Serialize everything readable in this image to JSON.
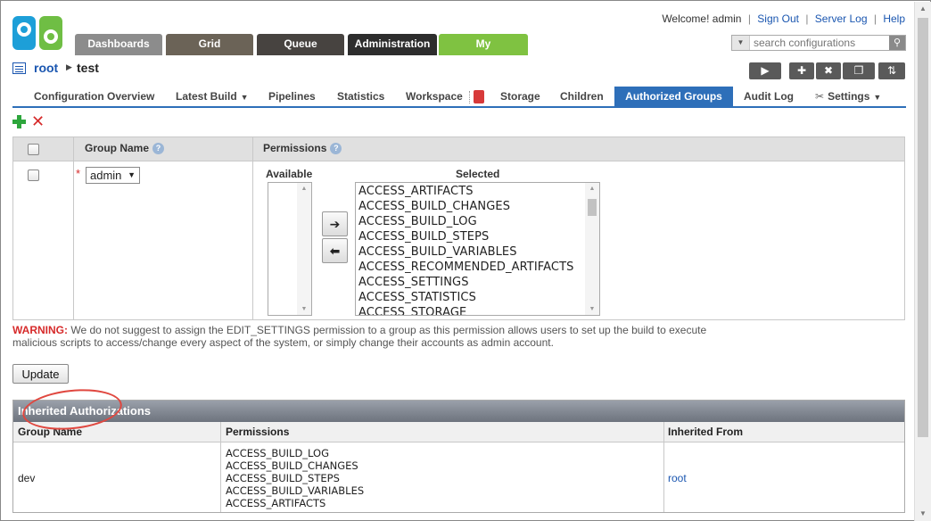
{
  "header": {
    "welcome": "Welcome! admin",
    "links": [
      "Sign Out",
      "Server Log",
      "Help"
    ],
    "search_placeholder": "search configurations"
  },
  "main_tabs": [
    {
      "label": "Dashboards",
      "color": "#8c8c8c"
    },
    {
      "label": "Grid",
      "color": "#6b6357"
    },
    {
      "label": "Queue",
      "color": "#474340"
    },
    {
      "label": "Administration",
      "color": "#2d2d2d"
    },
    {
      "label": "My",
      "color": "#7fc241"
    }
  ],
  "breadcrumb": {
    "root": "root",
    "current": "test"
  },
  "toolbar_icons": [
    "play-icon",
    "plus-icon",
    "close-icon",
    "clone-icon",
    "sort-icon"
  ],
  "sub_tabs": [
    "Configuration Overview",
    "Latest Build",
    "Pipelines",
    "Statistics",
    "Workspace",
    "Storage",
    "Children",
    "Authorized Groups",
    "Audit Log",
    "Settings"
  ],
  "active_sub_tab": "Authorized Groups",
  "groups_table": {
    "col_group": "Group Name",
    "col_permissions": "Permissions",
    "help": "?",
    "required_mark": "*",
    "group_value": "admin",
    "available_label": "Available",
    "selected_label": "Selected",
    "selected_items": [
      "ACCESS_ARTIFACTS",
      "ACCESS_BUILD_CHANGES",
      "ACCESS_BUILD_LOG",
      "ACCESS_BUILD_STEPS",
      "ACCESS_BUILD_VARIABLES",
      "ACCESS_RECOMMENDED_ARTIFACTS",
      "ACCESS_SETTINGS",
      "ACCESS_STATISTICS",
      "ACCESS_STORAGE"
    ]
  },
  "warning": {
    "label": "WARNING:",
    "text": " We do not suggest to assign the EDIT_SETTINGS permission to a group as this permission allows users to set up the build to execute malicious scripts to access/change every aspect of the system, or simply change their accounts as admin account."
  },
  "update_label": "Update",
  "inherited": {
    "title": "Inherited Authorizations",
    "col_group": "Group Name",
    "col_permissions": "Permissions",
    "col_from": "Inherited From",
    "rows": [
      {
        "group": "dev",
        "permissions": [
          "ACCESS_BUILD_LOG",
          "ACCESS_BUILD_CHANGES",
          "ACCESS_BUILD_STEPS",
          "ACCESS_BUILD_VARIABLES",
          "ACCESS_ARTIFACTS"
        ],
        "from": "root"
      }
    ]
  },
  "colors": {
    "accent_blue": "#2e6fb9",
    "link_blue": "#1a56b0",
    "warning_red": "#d62a2a",
    "add_green": "#2da63c"
  }
}
